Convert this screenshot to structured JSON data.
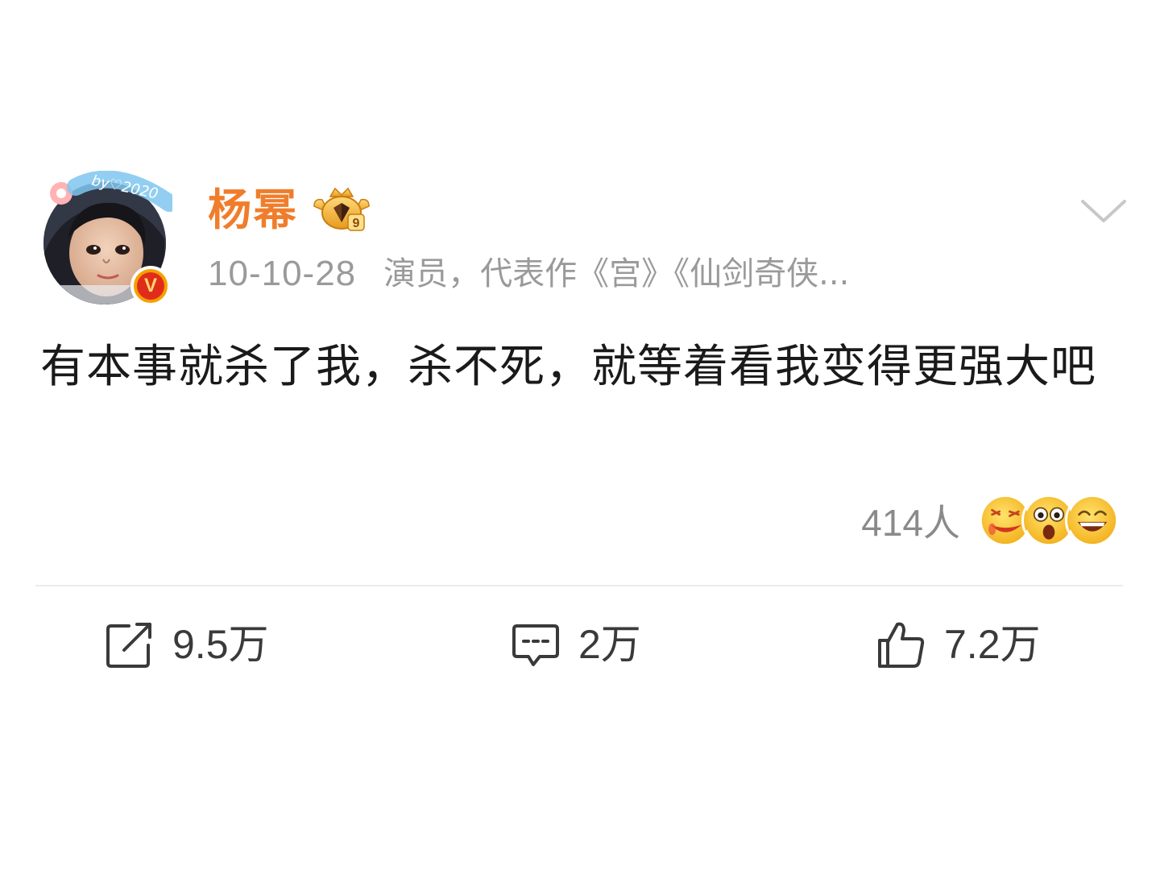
{
  "post": {
    "author": {
      "name": "杨幂",
      "avatar_ribbon_text": "by♡2020",
      "verified_mark": "V"
    },
    "meta": {
      "date": "10-10-28",
      "bio": "演员，代表作《宫》《仙剑奇侠..."
    },
    "content": "有本事就杀了我，杀不死，就等着看我变得更强大吧",
    "reactions": {
      "count_label": "414人",
      "emojis": [
        "laughing-tears-emoji",
        "shocked-emoji",
        "grinning-emoji"
      ]
    },
    "actions": {
      "repost_count": "9.5万",
      "comment_count": "2万",
      "like_count": "7.2万"
    }
  },
  "colors": {
    "username": "#f07d2b",
    "meta_text": "#9a9a9a",
    "content_text": "#1a1a1a",
    "action_icon": "#3a3a3a",
    "verified_bg": "#e02d1b",
    "verified_ring": "#f5a000"
  }
}
